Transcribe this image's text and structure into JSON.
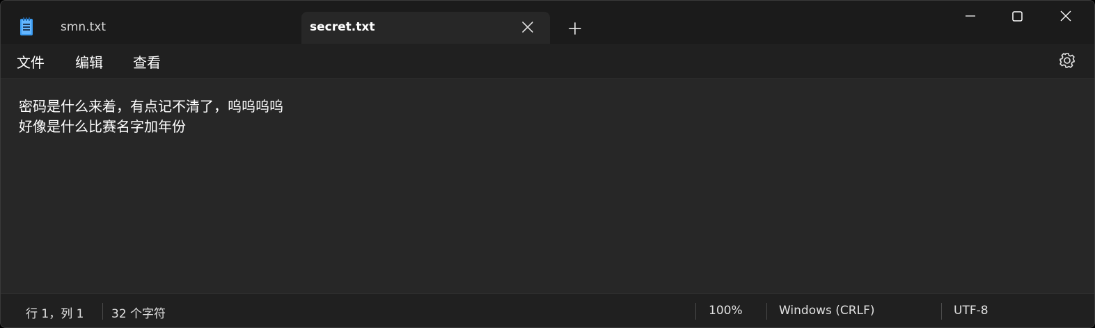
{
  "tabs": [
    {
      "label": "smn.txt",
      "active": false
    },
    {
      "label": "secret.txt",
      "active": true
    }
  ],
  "icons": {
    "app": "notepad-icon",
    "tab_close": "close-icon",
    "new_tab": "plus-icon",
    "minimize": "minimize-icon",
    "maximize": "maximize-icon",
    "close": "close-icon",
    "settings": "gear-icon"
  },
  "menu": {
    "file": "文件",
    "edit": "编辑",
    "view": "查看"
  },
  "editor": {
    "content": "密码是什么来着，有点记不清了，呜呜呜呜\n好像是什么比赛名字加年份"
  },
  "status": {
    "position": "行 1，列 1",
    "char_count": "32 个字符",
    "zoom": "100%",
    "line_ending": "Windows (CRLF)",
    "encoding": "UTF-8"
  },
  "colors": {
    "background": "#272727",
    "titlebar": "#1b1b1b",
    "bars": "#202020",
    "text": "#ffffff",
    "icon_accent": "#4aa3ff"
  }
}
